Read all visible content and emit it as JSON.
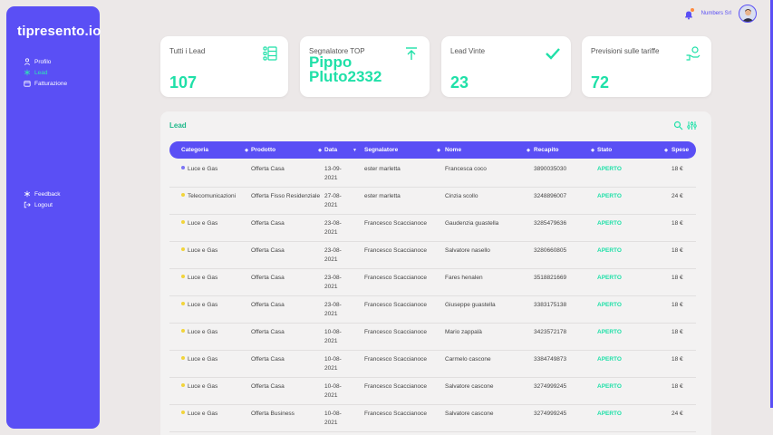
{
  "app": {
    "logo": "tipresento.io",
    "company": "Numbers Srl"
  },
  "sidebar": {
    "items": [
      {
        "label": "Profilo",
        "icon": "user-icon",
        "active": false
      },
      {
        "label": "Lead",
        "icon": "asterisk-icon",
        "active": true
      },
      {
        "label": "Fatturazione",
        "icon": "wallet-icon",
        "active": false
      }
    ],
    "bottom_items": [
      {
        "label": "Feedback",
        "icon": "feedback-icon"
      },
      {
        "label": "Logout",
        "icon": "logout-icon"
      }
    ]
  },
  "cards": [
    {
      "label": "Tutti i Lead",
      "value": "107",
      "icon": "list-icon"
    },
    {
      "label": "Segnalatore TOP",
      "value": "Pippo Pluto2332",
      "icon": "upload-icon"
    },
    {
      "label": "Lead Vinte",
      "value": "23",
      "icon": "check-icon"
    },
    {
      "label": "Previsioni sulle tariffe",
      "value": "72",
      "icon": "hand-money-icon"
    }
  ],
  "panel": {
    "title": "Lead"
  },
  "table": {
    "headers": [
      "Categoria",
      "Prodotto",
      "Data",
      "Segnalatore",
      "Nome",
      "Recapito",
      "Stato",
      "Spese"
    ],
    "rows": [
      {
        "dot": "#7b74f5",
        "categoria": "Luce e Gas",
        "prodotto": "Offerta Casa",
        "data": "13-09-2021",
        "segnalatore": "ester marletta",
        "nome": "Francesca coco",
        "recapito": "3890035030",
        "stato": "APERTO",
        "spese": "18 €"
      },
      {
        "dot": "#f2d43a",
        "categoria": "Telecomunicazioni",
        "prodotto": "Offerta Fisso Residenziale",
        "data": "27-08-2021",
        "segnalatore": "ester marletta",
        "nome": "Cinzia scollo",
        "recapito": "3248896007",
        "stato": "APERTO",
        "spese": "24 €"
      },
      {
        "dot": "#f2d43a",
        "categoria": "Luce e Gas",
        "prodotto": "Offerta Casa",
        "data": "23-08-2021",
        "segnalatore": "Francesco Scaccianoce",
        "nome": "Gaudenzia guastella",
        "recapito": "3285479636",
        "stato": "APERTO",
        "spese": "18 €"
      },
      {
        "dot": "#f2d43a",
        "categoria": "Luce e Gas",
        "prodotto": "Offerta Casa",
        "data": "23-08-2021",
        "segnalatore": "Francesco Scaccianoce",
        "nome": "Salvatore nasello",
        "recapito": "3280660805",
        "stato": "APERTO",
        "spese": "18 €"
      },
      {
        "dot": "#f2d43a",
        "categoria": "Luce e Gas",
        "prodotto": "Offerta Casa",
        "data": "23-08-2021",
        "segnalatore": "Francesco Scaccianoce",
        "nome": "Fares henalen",
        "recapito": "3518821669",
        "stato": "APERTO",
        "spese": "18 €"
      },
      {
        "dot": "#f2d43a",
        "categoria": "Luce e Gas",
        "prodotto": "Offerta Casa",
        "data": "23-08-2021",
        "segnalatore": "Francesco Scaccianoce",
        "nome": "Giuseppe guastella",
        "recapito": "3383175138",
        "stato": "APERTO",
        "spese": "18 €"
      },
      {
        "dot": "#f2d43a",
        "categoria": "Luce e Gas",
        "prodotto": "Offerta Casa",
        "data": "10-08-2021",
        "segnalatore": "Francesco Scaccianoce",
        "nome": "Mario zappalà",
        "recapito": "3423572178",
        "stato": "APERTO",
        "spese": "18 €"
      },
      {
        "dot": "#f2d43a",
        "categoria": "Luce e Gas",
        "prodotto": "Offerta Casa",
        "data": "10-08-2021",
        "segnalatore": "Francesco Scaccianoce",
        "nome": "Carmelo cascone",
        "recapito": "3384749873",
        "stato": "APERTO",
        "spese": "18 €"
      },
      {
        "dot": "#f2d43a",
        "categoria": "Luce e Gas",
        "prodotto": "Offerta Casa",
        "data": "10-08-2021",
        "segnalatore": "Francesco Scaccianoce",
        "nome": "Salvatore cascone",
        "recapito": "3274999245",
        "stato": "APERTO",
        "spese": "18 €"
      },
      {
        "dot": "#f2d43a",
        "categoria": "Luce e Gas",
        "prodotto": "Offerta Business",
        "data": "10-08-2021",
        "segnalatore": "Francesco Scaccianoce",
        "nome": "Salvatore cascone",
        "recapito": "3274999245",
        "stato": "APERTO",
        "spese": "24 €"
      }
    ]
  }
}
